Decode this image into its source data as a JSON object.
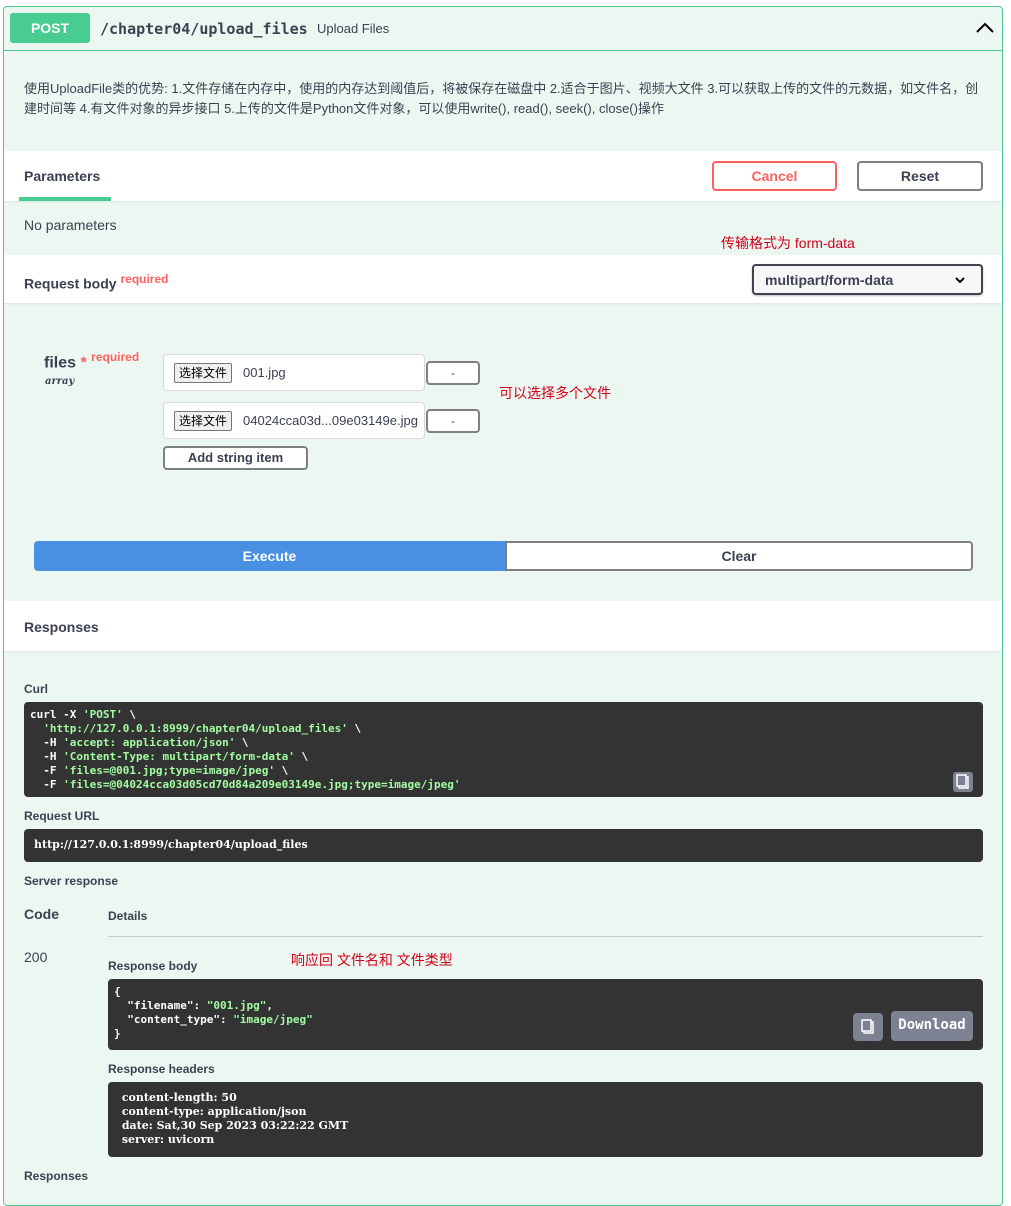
{
  "operation": {
    "method": "POST",
    "path": "/chapter04/upload_files",
    "summary": "Upload Files",
    "description": "使用UploadFile类的优势: 1.文件存储在内存中，使用的内存达到阈值后，将被保存在磁盘中 2.适合于图片、视频大文件 3.可以获取上传的文件的元数据，如文件名，创建时间等 4.有文件对象的异步接口 5.上传的文件是Python文件对象，可以使用write(), read(), seek(), close()操作"
  },
  "parameters": {
    "title": "Parameters",
    "cancel_label": "Cancel",
    "reset_label": "Reset",
    "none_text": "No parameters"
  },
  "request_body": {
    "title": "Request body",
    "required_label": "required",
    "content_type": "multipart/form-data",
    "annotation_format": "传输格式为 form-data",
    "field": {
      "name": "files",
      "star": "*",
      "required_label": "required",
      "type": "array"
    },
    "files": [
      {
        "choose_label": "选择文件",
        "filename": "001.jpg",
        "remove_label": "-"
      },
      {
        "choose_label": "选择文件",
        "filename": "04024cca03d...09e03149e.jpg",
        "remove_label": "-"
      }
    ],
    "annotation_multi": "可以选择多个文件",
    "add_item_label": "Add string item"
  },
  "actions": {
    "execute_label": "Execute",
    "clear_label": "Clear"
  },
  "responses": {
    "title": "Responses",
    "curl_label": "Curl",
    "curl_lines": [
      {
        "plain": "curl -X ",
        "str": "'POST'",
        "tail": " \\"
      },
      {
        "plain": "  ",
        "str": "'http://127.0.0.1:8999/chapter04/upload_files'",
        "tail": " \\"
      },
      {
        "plain": "  -H ",
        "str": "'accept: application/json'",
        "tail": " \\"
      },
      {
        "plain": "  -H ",
        "str": "'Content-Type: multipart/form-data'",
        "tail": " \\"
      },
      {
        "plain": "  -F ",
        "str": "'files=@001.jpg;type=image/jpeg'",
        "tail": " \\"
      },
      {
        "plain": "  -F ",
        "str": "'files=@04024cca03d05cd70d84a209e03149e.jpg;type=image/jpeg'",
        "tail": ""
      }
    ],
    "request_url_label": "Request URL",
    "request_url": "http://127.0.0.1:8999/chapter04/upload_files",
    "server_response_label": "Server response",
    "code_header": "Code",
    "details_header": "Details",
    "status_code": "200",
    "response_body_label": "Response body",
    "annotation_response": "响应回 文件名和 文件类型",
    "body_lines": [
      {
        "plain": "{",
        "str": "",
        "tail": ""
      },
      {
        "plain": "  \"filename\": ",
        "str": "\"001.jpg\"",
        "tail": ","
      },
      {
        "plain": "  \"content_type\": ",
        "str": "\"image/jpeg\"",
        "tail": ""
      },
      {
        "plain": "}",
        "str": "",
        "tail": ""
      }
    ],
    "download_label": "Download",
    "response_headers_label": "Response headers",
    "header_lines": [
      " content-length: 50",
      " content-type: application/json",
      " date: Sat,30 Sep 2023 03:22:22 GMT",
      " server: uvicorn"
    ],
    "footer_title": "Responses"
  },
  "colors": {
    "post_green": "#49cc90",
    "cancel_red": "#ff6060",
    "execute_blue": "#4990e2",
    "annotation_red": "#d0021b",
    "code_bg": "#333333",
    "string_green": "#a2fca2"
  },
  "icons": [
    "chevron-up-icon",
    "dropdown-chevron-icon",
    "copy-icon"
  ]
}
